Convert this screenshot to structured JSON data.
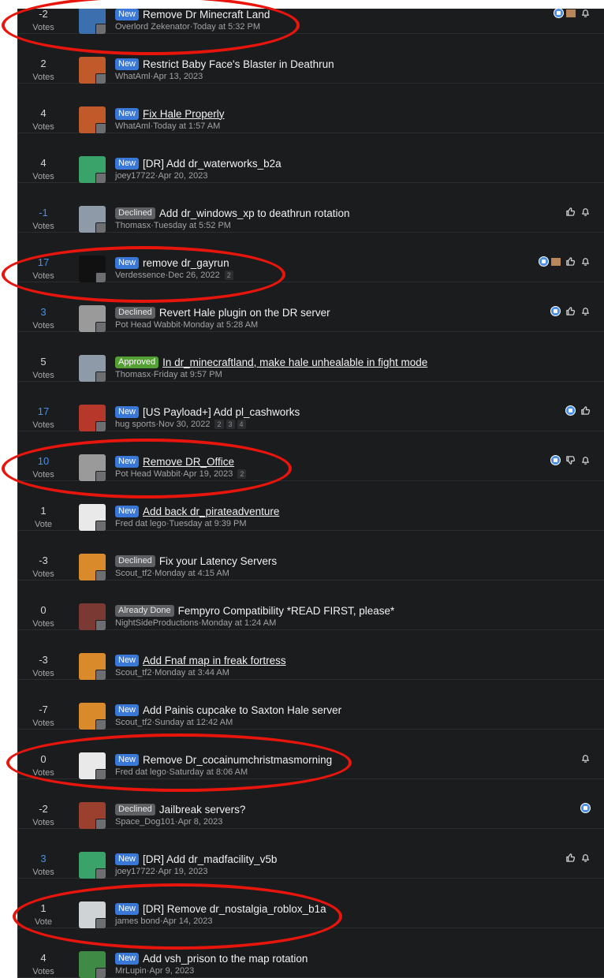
{
  "vote_label_plural": "Votes",
  "vote_label_single": "Vote",
  "colors": {
    "new": "#3a78d8",
    "declined": "#5f6063",
    "approved": "#55a035",
    "upvote_positive": "#4a8fe6",
    "highlight_circle": "#e8150c"
  },
  "threads": [
    {
      "votes": "-2",
      "vote_label": "Votes",
      "badge": "New",
      "title": "Remove Dr Minecraft Land",
      "author": "Overlord Zekenator",
      "date": "Today at 5:32 PM",
      "pages": [],
      "actions": [
        "reaction-badge",
        "reaction-box",
        "bell-icon"
      ],
      "avatar": "#3b6fae"
    },
    {
      "votes": "2",
      "vote_label": "Votes",
      "badge": "New",
      "title": "Restrict Baby Face's Blaster in Deathrun",
      "author": "WhatAml",
      "date": "Apr 13, 2023",
      "pages": [],
      "actions": [],
      "avatar": "#c05a2a"
    },
    {
      "votes": "4",
      "vote_label": "Votes",
      "badge": "New",
      "title": "Fix Hale Properly",
      "author": "WhatAml",
      "date": "Today at 1:57 AM",
      "pages": [],
      "actions": [],
      "avatar": "#c05a2a"
    },
    {
      "votes": "4",
      "vote_label": "Votes",
      "badge": "New",
      "title": "[DR] Add dr_waterworks_b2a",
      "author": "joey17722",
      "date": "Apr 20, 2023",
      "pages": [],
      "actions": [],
      "avatar": "#3aa36a"
    },
    {
      "votes": "-1",
      "vote_label": "Votes",
      "badge": "Declined",
      "title": "Add dr_windows_xp to deathrun rotation",
      "author": "Thomasx",
      "date": "Tuesday at 5:52 PM",
      "pages": [],
      "actions": [
        "thumbs-up-icon",
        "bell-icon"
      ],
      "avatar": "#8e9aa8"
    },
    {
      "votes": "17",
      "vote_label": "Votes",
      "badge": "New",
      "title": "remove dr_gayrun",
      "author": "Verdessence",
      "date": "Dec 26, 2022",
      "pages": [
        "2"
      ],
      "actions": [
        "reaction-badge",
        "reaction-box",
        "thumbs-up-icon",
        "bell-icon"
      ],
      "avatar": "#111111"
    },
    {
      "votes": "3",
      "vote_label": "Votes",
      "badge": "Declined",
      "title": "Revert Hale plugin on the DR server",
      "author": "Pot Head Wabbit",
      "date": "Monday at 5:28 AM",
      "pages": [],
      "actions": [
        "reaction-badge",
        "thumbs-up-icon",
        "bell-icon"
      ],
      "avatar": "#9a9a9a"
    },
    {
      "votes": "5",
      "vote_label": "Votes",
      "badge": "Approved",
      "title": "In dr_minecraftland, make hale unhealable in fight mode",
      "author": "Thomasx",
      "date": "Friday at 9:57 PM",
      "pages": [],
      "actions": [],
      "avatar": "#8e9aa8"
    },
    {
      "votes": "17",
      "vote_label": "Votes",
      "badge": "New",
      "title": "[US Payload+] Add pl_cashworks",
      "author": "hug sports",
      "date": "Nov 30, 2022",
      "pages": [
        "2",
        "3",
        "4"
      ],
      "actions": [
        "reaction-badge",
        "thumbs-up-icon"
      ],
      "avatar": "#b5382a"
    },
    {
      "votes": "10",
      "vote_label": "Votes",
      "badge": "New",
      "title": "Remove DR_Office",
      "author": "Pot Head Wabbit",
      "date": "Apr 19, 2023",
      "pages": [
        "2"
      ],
      "actions": [
        "reaction-badge",
        "thumbs-down-icon",
        "bell-icon"
      ],
      "avatar": "#9a9a9a"
    },
    {
      "votes": "1",
      "vote_label": "Vote",
      "badge": "New",
      "title": "Add back dr_pirateadventure",
      "author": "Fred dat lego",
      "date": "Tuesday at 9:39 PM",
      "pages": [],
      "actions": [],
      "avatar": "#e9e9e9"
    },
    {
      "votes": "-3",
      "vote_label": "Votes",
      "badge": "Declined",
      "title": "Fix your Latency Servers",
      "author": "Scout_tf2",
      "date": "Monday at 4:15 AM",
      "pages": [],
      "actions": [],
      "avatar": "#d98a2b"
    },
    {
      "votes": "0",
      "vote_label": "Votes",
      "badge": "Already Done",
      "title": "Fempyro Compatibility *READ FIRST, please*",
      "author": "NightSideProductions",
      "date": "Monday at 1:24 AM",
      "pages": [],
      "actions": [],
      "avatar": "#7a3a33"
    },
    {
      "votes": "-3",
      "vote_label": "Votes",
      "badge": "New",
      "title": "Add Fnaf map in freak fortress",
      "author": "Scout_tf2",
      "date": "Monday at 3:44 AM",
      "pages": [],
      "actions": [],
      "avatar": "#d98a2b"
    },
    {
      "votes": "-7",
      "vote_label": "Votes",
      "badge": "New",
      "title": "Add Painis cupcake to Saxton Hale server",
      "author": "Scout_tf2",
      "date": "Sunday at 12:42 AM",
      "pages": [],
      "actions": [],
      "avatar": "#d98a2b"
    },
    {
      "votes": "0",
      "vote_label": "Votes",
      "badge": "New",
      "title": "Remove Dr_cocainumchristmasmorning",
      "author": "Fred dat lego",
      "date": "Saturday at 8:06 AM",
      "pages": [],
      "actions": [
        "bell-icon"
      ],
      "avatar": "#e9e9e9"
    },
    {
      "votes": "-2",
      "vote_label": "Votes",
      "badge": "Declined",
      "title": "Jailbreak servers?",
      "author": "Space_Dog101",
      "date": "Apr 8, 2023",
      "pages": [],
      "actions": [
        "reaction-badge"
      ],
      "avatar": "#9b3f2f"
    },
    {
      "votes": "3",
      "vote_label": "Votes",
      "badge": "New",
      "title": "[DR] Add dr_madfacility_v5b",
      "author": "joey17722",
      "date": "Apr 19, 2023",
      "pages": [],
      "actions": [
        "thumbs-up-icon",
        "bell-icon"
      ],
      "avatar": "#3aa36a"
    },
    {
      "votes": "1",
      "vote_label": "Vote",
      "badge": "New",
      "title": "[DR] Remove dr_nostalgia_roblox_b1a",
      "author": "james bond",
      "date": "Apr 14, 2023",
      "pages": [],
      "actions": [],
      "avatar": "#cfd3d6"
    },
    {
      "votes": "4",
      "vote_label": "Votes",
      "badge": "New",
      "title": "Add vsh_prison to the map rotation",
      "author": "MrLupin",
      "date": "Apr 9, 2023",
      "pages": [],
      "actions": [],
      "avatar": "#3f8a44"
    }
  ]
}
